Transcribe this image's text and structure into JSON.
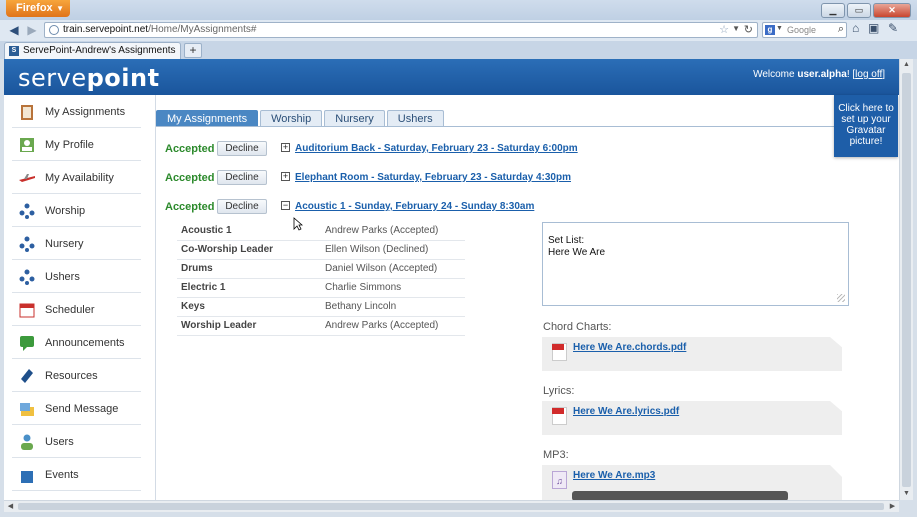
{
  "browser": {
    "app_button": "Firefox",
    "url_host": "train.servepoint.net",
    "url_path": "/Home/MyAssignments#",
    "search_placeholder": "Google",
    "tab_title": "ServePoint-Andrew's Assignments",
    "new_tab_label": "+"
  },
  "header": {
    "logo_light": "serve",
    "logo_bold": "point",
    "welcome_prefix": "Welcome ",
    "username": "user.alpha",
    "bracket_open": "! [",
    "logout_label": "log off",
    "bracket_close": "]"
  },
  "sidebar": {
    "items": [
      {
        "label": "My Assignments",
        "icon": "clipboard-icon"
      },
      {
        "label": "My Profile",
        "icon": "profile-icon"
      },
      {
        "label": "My Availability",
        "icon": "airplane-icon"
      },
      {
        "label": "Worship",
        "icon": "team-icon"
      },
      {
        "label": "Nursery",
        "icon": "team-icon"
      },
      {
        "label": "Ushers",
        "icon": "team-icon"
      },
      {
        "label": "Scheduler",
        "icon": "calendar-icon"
      },
      {
        "label": "Announcements",
        "icon": "announcement-icon"
      },
      {
        "label": "Resources",
        "icon": "book-icon"
      },
      {
        "label": "Send Message",
        "icon": "envelope-icon"
      },
      {
        "label": "Users",
        "icon": "users-icon"
      },
      {
        "label": "Events",
        "icon": "events-icon"
      }
    ]
  },
  "tabs": [
    "My Assignments",
    "Worship",
    "Nursery",
    "Ushers"
  ],
  "assignments": [
    {
      "status": "Accepted",
      "decline_label": "Decline",
      "toggle": "+",
      "title": "Auditorium Back - Saturday, February 23 - Saturday 6:00pm"
    },
    {
      "status": "Accepted",
      "decline_label": "Decline",
      "toggle": "+",
      "title": "Elephant Room - Saturday, February 23 - Saturday 4:30pm"
    },
    {
      "status": "Accepted",
      "decline_label": "Decline",
      "toggle": "−",
      "title": "Acoustic 1 - Sunday, February 24 - Sunday 8:30am"
    }
  ],
  "roles": [
    {
      "role": "Acoustic 1",
      "person": "Andrew Parks (Accepted)"
    },
    {
      "role": "Co-Worship Leader",
      "person": "Ellen Wilson (Declined)"
    },
    {
      "role": "Drums",
      "person": "Daniel Wilson (Accepted)"
    },
    {
      "role": "Electric 1",
      "person": "Charlie Simmons"
    },
    {
      "role": "Keys",
      "person": "Bethany Lincoln"
    },
    {
      "role": "Worship Leader",
      "person": "Andrew Parks (Accepted)"
    }
  ],
  "setlist": {
    "line1": "Set List:",
    "line2": "Here We Are"
  },
  "files": {
    "chord_label": "Chord Charts:",
    "chord_file": "Here We Are.chords.pdf",
    "lyrics_label": "Lyrics:",
    "lyrics_file": "Here We Are.lyrics.pdf",
    "mp3_label": "MP3:",
    "mp3_file": "Here We Are.mp3"
  },
  "gravatar": {
    "line1": "Click here to",
    "line2": "set up your",
    "line3": "Gravatar",
    "line4": "picture!"
  },
  "colors": {
    "header_blue": "#1a559c",
    "accepted_green": "#2c8a2c",
    "link_blue": "#1a5fab",
    "active_tab": "#4a87c3"
  }
}
